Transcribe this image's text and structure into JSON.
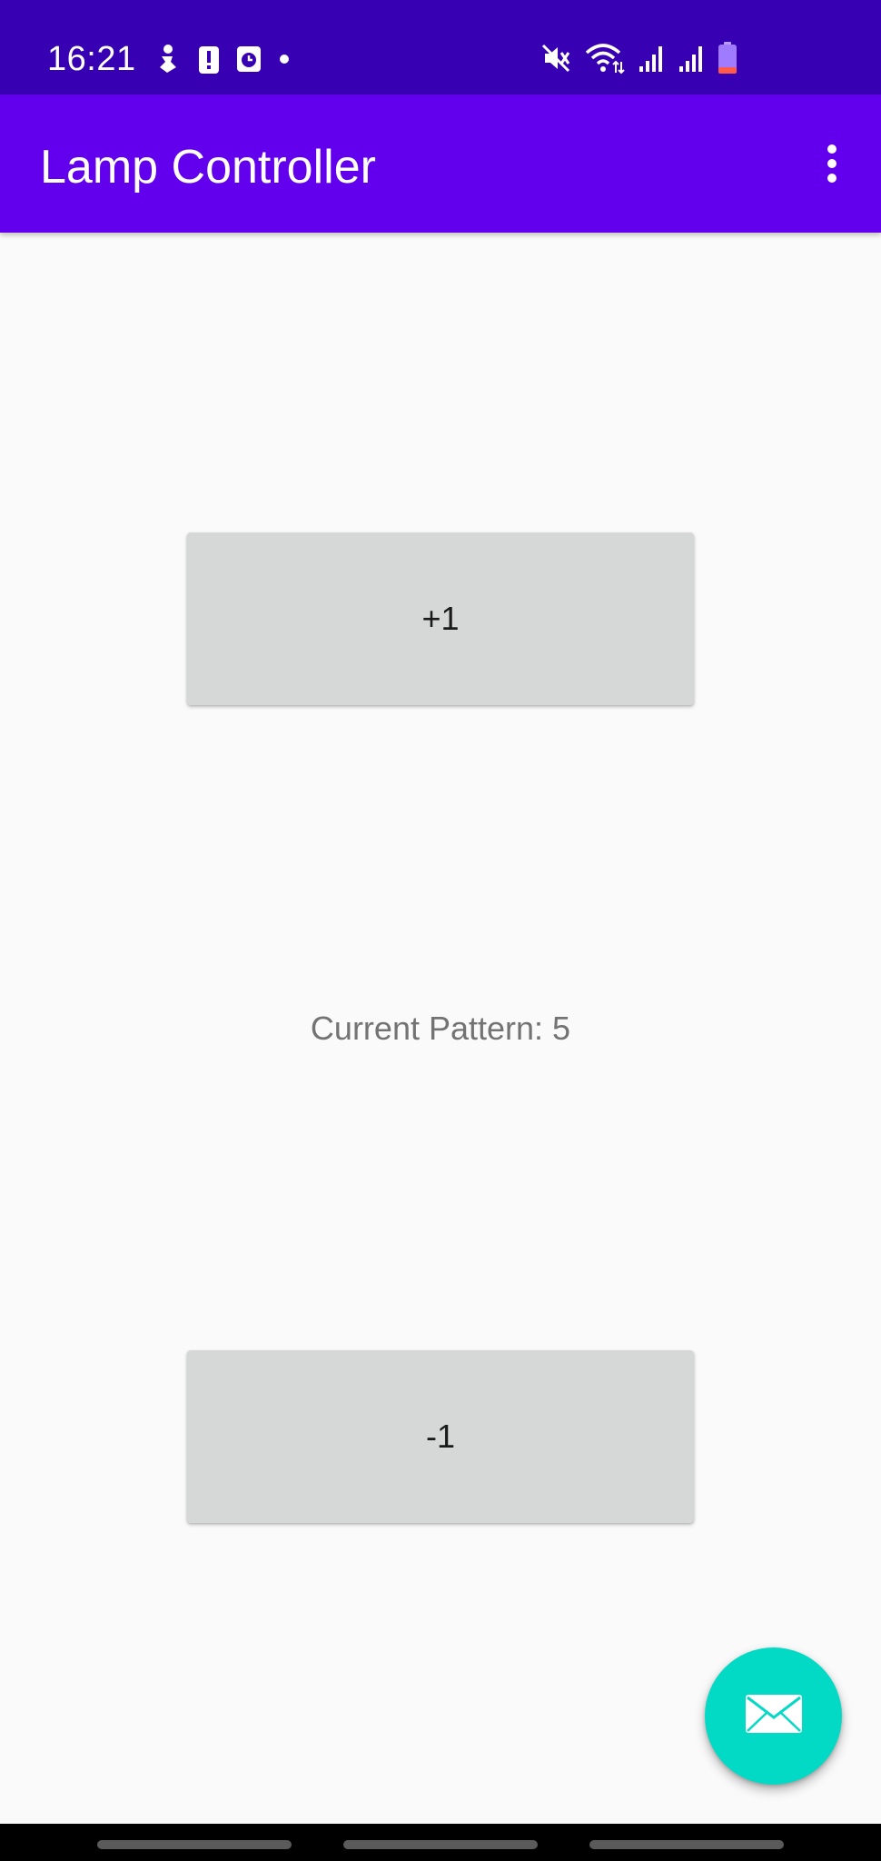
{
  "status_bar": {
    "time": "16:21",
    "left_icons": [
      "person-icon",
      "battery-alert-icon",
      "clock-app-icon",
      "dot-icon"
    ],
    "right_icons": [
      "mute-icon",
      "wifi-icon",
      "signal-icon",
      "signal-icon",
      "battery-low-icon"
    ],
    "background": "#3700b3"
  },
  "app_bar": {
    "title": "Lamp Controller",
    "background": "#6200ee",
    "menu_icon": "more-vert-icon"
  },
  "main": {
    "increment_label": "+1",
    "decrement_label": "-1",
    "pattern_text": "Current Pattern: 5"
  },
  "fab": {
    "icon": "mail-icon",
    "color": "#03dac5"
  },
  "nav_bar": {
    "background": "#000000"
  }
}
